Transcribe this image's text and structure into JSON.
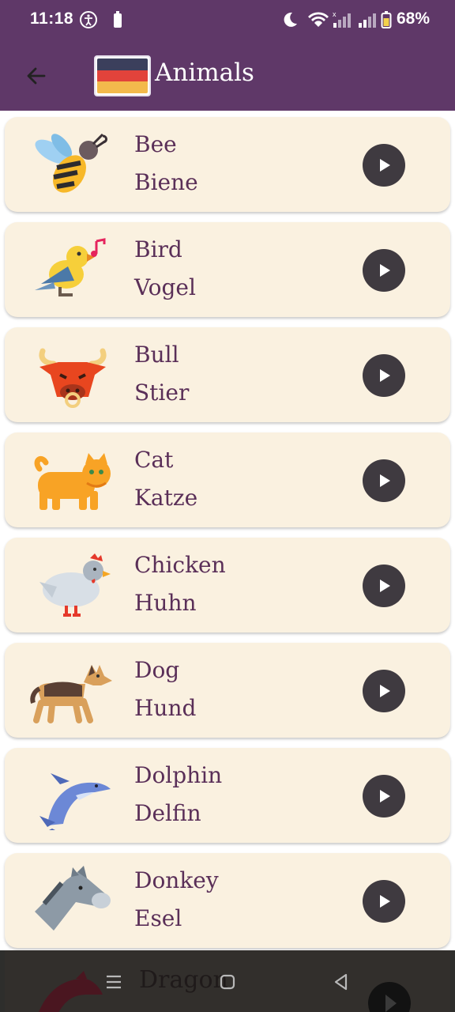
{
  "status_bar": {
    "time": "11:18",
    "battery_percent": "68%"
  },
  "app_bar": {
    "title": "Animals",
    "back_icon": "arrow-left-icon",
    "flag": "germany-flag"
  },
  "animals": [
    {
      "english": "Bee",
      "german": "Biene",
      "icon": "bee-icon"
    },
    {
      "english": "Bird",
      "german": "Vogel",
      "icon": "bird-icon"
    },
    {
      "english": "Bull",
      "german": "Stier",
      "icon": "bull-icon"
    },
    {
      "english": "Cat",
      "german": "Katze",
      "icon": "cat-icon"
    },
    {
      "english": "Chicken",
      "german": "Huhn",
      "icon": "chicken-icon"
    },
    {
      "english": "Dog",
      "german": "Hund",
      "icon": "dog-icon"
    },
    {
      "english": "Dolphin",
      "german": "Delfin",
      "icon": "dolphin-icon"
    },
    {
      "english": "Donkey",
      "german": "Esel",
      "icon": "donkey-icon"
    },
    {
      "english": "Dragon",
      "german": "",
      "icon": "dragon-icon"
    }
  ],
  "colors": {
    "primary": "#5f3868",
    "card_bg": "#faf1e0",
    "text": "#5a2f58",
    "play_button": "#3f3a40"
  }
}
